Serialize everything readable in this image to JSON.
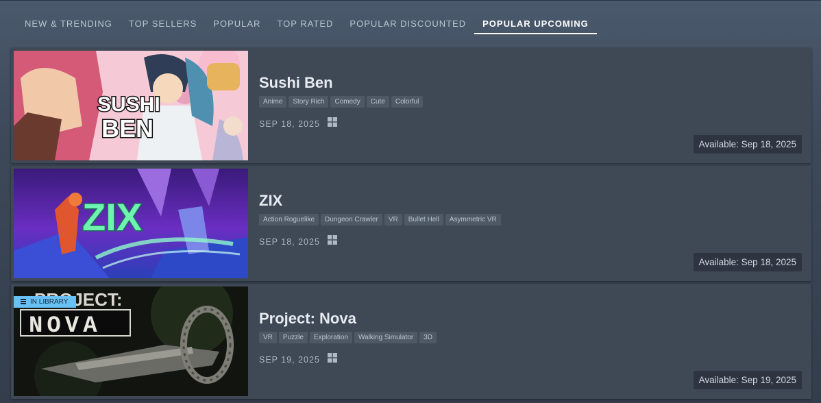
{
  "tabs": [
    {
      "label": "NEW & TRENDING",
      "active": false
    },
    {
      "label": "TOP SELLERS",
      "active": false
    },
    {
      "label": "POPULAR",
      "active": false
    },
    {
      "label": "TOP RATED",
      "active": false
    },
    {
      "label": "POPULAR DISCOUNTED",
      "active": false
    },
    {
      "label": "POPULAR UPCOMING",
      "active": true
    }
  ],
  "games": [
    {
      "title": "Sushi Ben",
      "capsule_text": [
        "SUSHI",
        "BEN"
      ],
      "tags": [
        "Anime",
        "Story Rich",
        "Comedy",
        "Cute",
        "Colorful"
      ],
      "date": "SEP 18, 2025",
      "platform_icon": "windows-icon",
      "availability": "Available: Sep 18, 2025"
    },
    {
      "title": "ZIX",
      "capsule_text": [
        "ZIX"
      ],
      "tags": [
        "Action Roguelike",
        "Dungeon Crawler",
        "VR",
        "Bullet Hell",
        "Asymmetric VR"
      ],
      "date": "SEP 18, 2025",
      "platform_icon": "windows-icon",
      "availability": "Available: Sep 18, 2025"
    },
    {
      "title": "Project: Nova",
      "capsule_text": [
        "PROJECT:",
        "NOVA"
      ],
      "badge": "IN LIBRARY",
      "tags": [
        "VR",
        "Puzzle",
        "Exploration",
        "Walking Simulator",
        "3D"
      ],
      "date": "SEP 19, 2025",
      "platform_icon": "windows-icon",
      "availability": "Available: Sep 19, 2025"
    }
  ],
  "colors": {
    "background": "#3d4959",
    "row_background": "#3f4855",
    "tag_background": "#4f5966",
    "availability_background": "#2e3541",
    "badge": "#67c1f5",
    "active_tab": "#ffffff"
  }
}
